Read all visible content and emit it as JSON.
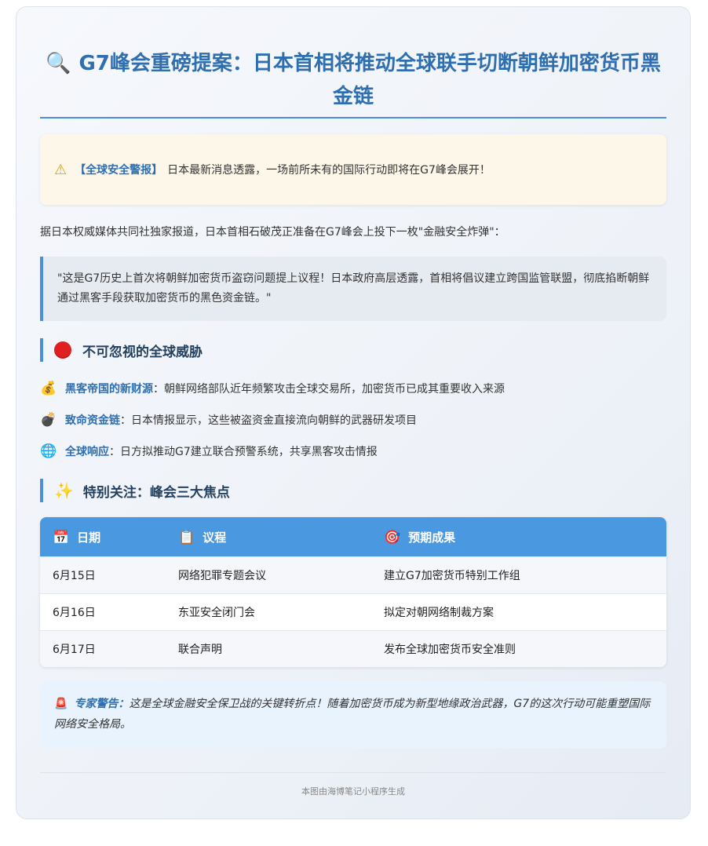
{
  "header": {
    "icon": "magnifier-icon",
    "title": "G7峰会重磅提案：日本首相将推动全球联手切断朝鲜加密货币黑金链"
  },
  "alert": {
    "icon": "warning-icon",
    "tag": "【全球安全警报】",
    "text": "日本最新消息透露，一场前所未有的国际行动即将在G7峰会展开！"
  },
  "intro": "据日本权威媒体共同社独家报道，日本首相石破茂正准备在G7峰会上投下一枚\"金融安全炸弹\"：",
  "quote": "\"这是G7历史上首次将朝鲜加密货币盗窃问题提上议程！日本政府高层透露，首相将倡议建立跨国监管联盟，彻底掐断朝鲜通过黑客手段获取加密货币的黑色资金链。\"",
  "threats": {
    "heading": "不可忽视的全球威胁",
    "items": [
      {
        "icon": "money-bag-icon",
        "key": "黑客帝国的新财源",
        "text": "：朝鲜网络部队近年频繁攻击全球交易所，加密货币已成其重要收入来源"
      },
      {
        "icon": "bomb-icon",
        "key": "致命资金链",
        "text": "：日本情报显示，这些被盗资金直接流向朝鲜的武器研发项目"
      },
      {
        "icon": "globe-icon",
        "key": "全球响应",
        "text": "：日方拟推动G7建立联合预警系统，共享黑客攻击情报"
      }
    ]
  },
  "focus": {
    "heading": "特别关注：峰会三大焦点",
    "columns": [
      {
        "icon": "calendar-icon",
        "label": "日期"
      },
      {
        "icon": "clipboard-icon",
        "label": "议程"
      },
      {
        "icon": "target-icon",
        "label": "预期成果"
      }
    ],
    "rows": [
      [
        "6月15日",
        "网络犯罪专题会议",
        "建立G7加密货币特别工作组"
      ],
      [
        "6月16日",
        "东亚安全闭门会",
        "拟定对朝网络制裁方案"
      ],
      [
        "6月17日",
        "联合声明",
        "发布全球加密货币安全准则"
      ]
    ]
  },
  "expert": {
    "icon": "siren-icon",
    "key": "专家警告：",
    "text": "这是全球金融安全保卫战的关键转折点！随着加密货币成为新型地缘政治武器，G7的这次行动可能重塑国际网络安全格局。"
  },
  "footer": "本图由海博笔记小程序生成"
}
